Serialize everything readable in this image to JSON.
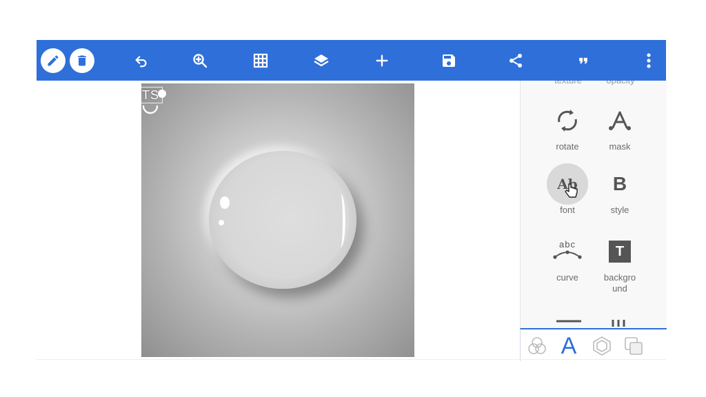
{
  "toolbar": {
    "color": "#2f6fd9",
    "buttons": [
      "pencil-icon",
      "trash-icon",
      "undo-icon",
      "zoom-icon",
      "grid-icon",
      "layers-icon",
      "plus-icon",
      "save-icon",
      "share-icon",
      "quote-icon",
      "more-icon"
    ]
  },
  "canvas": {
    "selected_text": "TS"
  },
  "panel": {
    "cut_top": [
      "texture",
      "opacity"
    ],
    "tools": [
      {
        "label": "rotate",
        "icon": "rotate-icon"
      },
      {
        "label": "mask",
        "icon": "mask-icon"
      },
      {
        "label": "font",
        "icon": "font-icon",
        "active": true,
        "glyph": "Ab"
      },
      {
        "label": "style",
        "icon": "bold-icon",
        "glyph": "B"
      },
      {
        "label": "curve",
        "icon": "curve-icon",
        "glyph": "abc"
      },
      {
        "label": "backgro\nund",
        "icon": "text-background-icon",
        "glyph": "T"
      }
    ]
  },
  "tabs": [
    "blend-icon",
    "text-icon",
    "shape-icon",
    "duplicate-icon"
  ],
  "tab_glyph_text": "A",
  "accent": "#2f6fd9"
}
